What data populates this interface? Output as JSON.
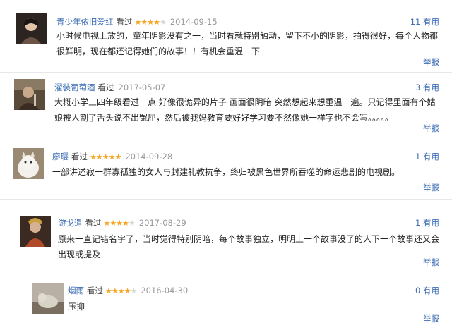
{
  "comments": [
    {
      "user": "青少年依旧爱红",
      "saw": "看过",
      "stars": 4,
      "date": "2014-09-15",
      "useful_count": "11",
      "useful_label": "有用",
      "content": "小时候电视上放的，童年阴影没有之一，当时看就特别触动，留下不小的阴影，拍得很好，每个人物都很鲜明，现在都还记得她们的故事！！有机会重温一下",
      "report": "举报"
    },
    {
      "user": "濯装葡萄酒",
      "saw": "看过",
      "stars": 0,
      "date": "2017-05-07",
      "useful_count": "3",
      "useful_label": "有用",
      "content": "大概小学三四年级看过一点 好像很诡异的片子 画面很阴暗 突然想起来想重温一遍。只记得里面有个姑娘被人割了舌头说不出冤屈，然后被我妈教育要好好学习要不然像她一样字也不会写。。。。。",
      "report": "举报"
    },
    {
      "user": "廖璎",
      "saw": "看过",
      "stars": 5,
      "date": "2014-09-28",
      "useful_count": "1",
      "useful_label": "有用",
      "content": "一部讲述寂一群寡孤独的女人与封建礼教抗争，终归被黑色世界所吞噬的命运悲剧的电视剧。",
      "report": "举报"
    },
    {
      "user": "游戈遣",
      "saw": "看过",
      "stars": 4,
      "date": "2017-08-29",
      "useful_count": "1",
      "useful_label": "有用",
      "content": "原来一直记错名字了，当时觉得特别阴暗，每个故事独立，明明上一个故事没了的人下一个故事还又会出现或提及",
      "report": "举报"
    },
    {
      "user": "烟雨",
      "saw": "看过",
      "stars": 4,
      "date": "2016-04-30",
      "useful_count": "0",
      "useful_label": "有用",
      "content": "压抑",
      "report": "举报"
    }
  ],
  "colors": {
    "link": "#3d6db3",
    "star": "#f5a623",
    "date": "#999999"
  }
}
